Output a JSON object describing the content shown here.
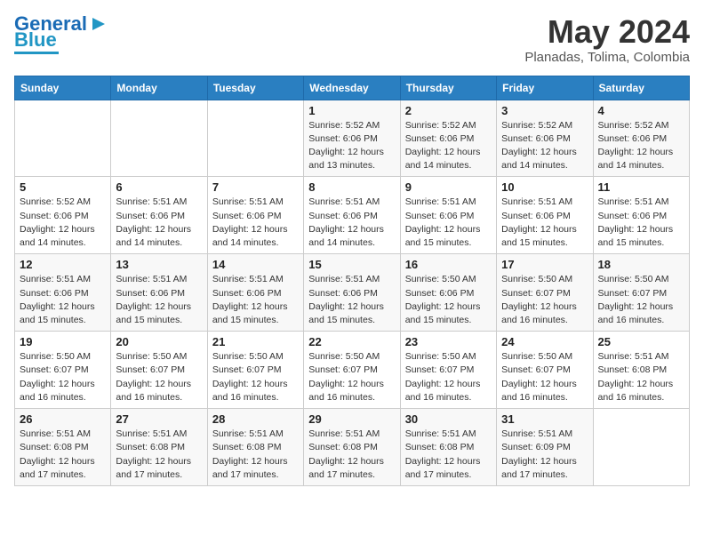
{
  "logo": {
    "text1": "General",
    "text2": "Blue"
  },
  "title": "May 2024",
  "location": "Planadas, Tolima, Colombia",
  "headers": [
    "Sunday",
    "Monday",
    "Tuesday",
    "Wednesday",
    "Thursday",
    "Friday",
    "Saturday"
  ],
  "weeks": [
    [
      {
        "day": "",
        "info": ""
      },
      {
        "day": "",
        "info": ""
      },
      {
        "day": "",
        "info": ""
      },
      {
        "day": "1",
        "info": "Sunrise: 5:52 AM\nSunset: 6:06 PM\nDaylight: 12 hours\nand 13 minutes."
      },
      {
        "day": "2",
        "info": "Sunrise: 5:52 AM\nSunset: 6:06 PM\nDaylight: 12 hours\nand 14 minutes."
      },
      {
        "day": "3",
        "info": "Sunrise: 5:52 AM\nSunset: 6:06 PM\nDaylight: 12 hours\nand 14 minutes."
      },
      {
        "day": "4",
        "info": "Sunrise: 5:52 AM\nSunset: 6:06 PM\nDaylight: 12 hours\nand 14 minutes."
      }
    ],
    [
      {
        "day": "5",
        "info": "Sunrise: 5:52 AM\nSunset: 6:06 PM\nDaylight: 12 hours\nand 14 minutes."
      },
      {
        "day": "6",
        "info": "Sunrise: 5:51 AM\nSunset: 6:06 PM\nDaylight: 12 hours\nand 14 minutes."
      },
      {
        "day": "7",
        "info": "Sunrise: 5:51 AM\nSunset: 6:06 PM\nDaylight: 12 hours\nand 14 minutes."
      },
      {
        "day": "8",
        "info": "Sunrise: 5:51 AM\nSunset: 6:06 PM\nDaylight: 12 hours\nand 14 minutes."
      },
      {
        "day": "9",
        "info": "Sunrise: 5:51 AM\nSunset: 6:06 PM\nDaylight: 12 hours\nand 15 minutes."
      },
      {
        "day": "10",
        "info": "Sunrise: 5:51 AM\nSunset: 6:06 PM\nDaylight: 12 hours\nand 15 minutes."
      },
      {
        "day": "11",
        "info": "Sunrise: 5:51 AM\nSunset: 6:06 PM\nDaylight: 12 hours\nand 15 minutes."
      }
    ],
    [
      {
        "day": "12",
        "info": "Sunrise: 5:51 AM\nSunset: 6:06 PM\nDaylight: 12 hours\nand 15 minutes."
      },
      {
        "day": "13",
        "info": "Sunrise: 5:51 AM\nSunset: 6:06 PM\nDaylight: 12 hours\nand 15 minutes."
      },
      {
        "day": "14",
        "info": "Sunrise: 5:51 AM\nSunset: 6:06 PM\nDaylight: 12 hours\nand 15 minutes."
      },
      {
        "day": "15",
        "info": "Sunrise: 5:51 AM\nSunset: 6:06 PM\nDaylight: 12 hours\nand 15 minutes."
      },
      {
        "day": "16",
        "info": "Sunrise: 5:50 AM\nSunset: 6:06 PM\nDaylight: 12 hours\nand 15 minutes."
      },
      {
        "day": "17",
        "info": "Sunrise: 5:50 AM\nSunset: 6:07 PM\nDaylight: 12 hours\nand 16 minutes."
      },
      {
        "day": "18",
        "info": "Sunrise: 5:50 AM\nSunset: 6:07 PM\nDaylight: 12 hours\nand 16 minutes."
      }
    ],
    [
      {
        "day": "19",
        "info": "Sunrise: 5:50 AM\nSunset: 6:07 PM\nDaylight: 12 hours\nand 16 minutes."
      },
      {
        "day": "20",
        "info": "Sunrise: 5:50 AM\nSunset: 6:07 PM\nDaylight: 12 hours\nand 16 minutes."
      },
      {
        "day": "21",
        "info": "Sunrise: 5:50 AM\nSunset: 6:07 PM\nDaylight: 12 hours\nand 16 minutes."
      },
      {
        "day": "22",
        "info": "Sunrise: 5:50 AM\nSunset: 6:07 PM\nDaylight: 12 hours\nand 16 minutes."
      },
      {
        "day": "23",
        "info": "Sunrise: 5:50 AM\nSunset: 6:07 PM\nDaylight: 12 hours\nand 16 minutes."
      },
      {
        "day": "24",
        "info": "Sunrise: 5:50 AM\nSunset: 6:07 PM\nDaylight: 12 hours\nand 16 minutes."
      },
      {
        "day": "25",
        "info": "Sunrise: 5:51 AM\nSunset: 6:08 PM\nDaylight: 12 hours\nand 16 minutes."
      }
    ],
    [
      {
        "day": "26",
        "info": "Sunrise: 5:51 AM\nSunset: 6:08 PM\nDaylight: 12 hours\nand 17 minutes."
      },
      {
        "day": "27",
        "info": "Sunrise: 5:51 AM\nSunset: 6:08 PM\nDaylight: 12 hours\nand 17 minutes."
      },
      {
        "day": "28",
        "info": "Sunrise: 5:51 AM\nSunset: 6:08 PM\nDaylight: 12 hours\nand 17 minutes."
      },
      {
        "day": "29",
        "info": "Sunrise: 5:51 AM\nSunset: 6:08 PM\nDaylight: 12 hours\nand 17 minutes."
      },
      {
        "day": "30",
        "info": "Sunrise: 5:51 AM\nSunset: 6:08 PM\nDaylight: 12 hours\nand 17 minutes."
      },
      {
        "day": "31",
        "info": "Sunrise: 5:51 AM\nSunset: 6:09 PM\nDaylight: 12 hours\nand 17 minutes."
      },
      {
        "day": "",
        "info": ""
      }
    ]
  ]
}
